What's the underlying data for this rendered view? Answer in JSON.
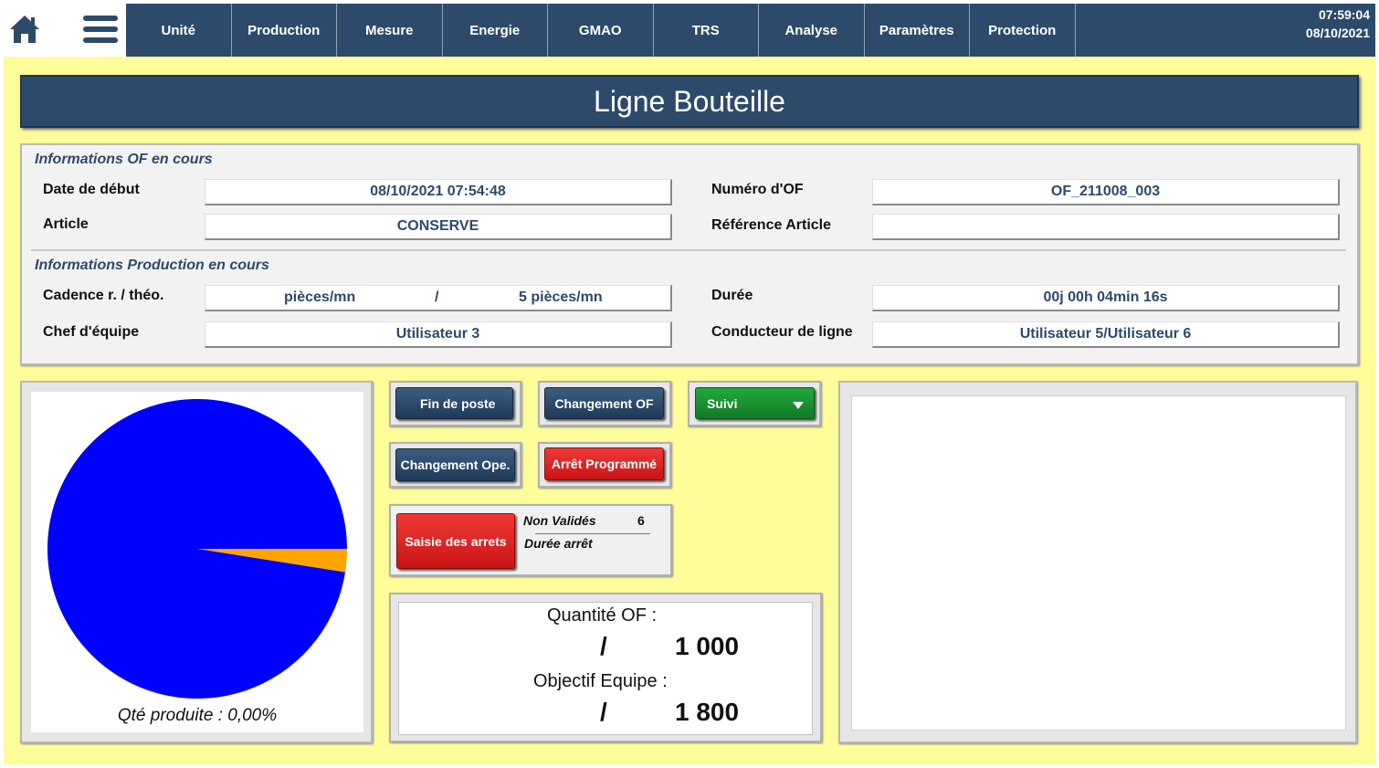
{
  "nav": {
    "items": [
      "Unité",
      "Production",
      "Mesure",
      "Energie",
      "GMAO",
      "TRS",
      "Analyse",
      "Paramètres",
      "Protection"
    ],
    "time": "07:59:04",
    "date": "08/10/2021"
  },
  "page_title": "Ligne Bouteille",
  "of_info": {
    "section_title": "Informations OF en cours",
    "start_date_label": "Date de début",
    "start_date_value": "08/10/2021 07:54:48",
    "of_number_label": "Numéro d'OF",
    "of_number_value": "OF_211008_003",
    "article_label": "Article",
    "article_value": "CONSERVE",
    "article_ref_label": "Référence Article",
    "article_ref_value": ""
  },
  "production_info": {
    "section_title": "Informations Production en cours",
    "cadence_label": "Cadence r. / théo.",
    "cadence_real": "pièces/mn",
    "cadence_sep": "/",
    "cadence_theo": "5 pièces/mn",
    "duration_label": "Durée",
    "duration_value": "00j 00h 04min 16s",
    "team_leader_label": "Chef d'équipe",
    "team_leader_value": "Utilisateur 3",
    "line_driver_label": "Conducteur de ligne",
    "line_driver_value": "Utilisateur 5/Utilisateur 6"
  },
  "buttons": {
    "end_shift": "Fin de poste",
    "change_of": "Changement OF",
    "followup": "Suivi",
    "change_ope": "Changement Ope.",
    "planned_stop": "Arrêt Programmé",
    "enter_stops": "Saisie des arrets"
  },
  "stops": {
    "not_validated_label": "Non Validés",
    "not_validated_value": "6",
    "stop_duration_label": "Durée arrêt"
  },
  "quantity": {
    "of_label": "Quantité OF :",
    "of_sep": "/",
    "of_value": "1 000",
    "team_label": "Objectif Equipe :",
    "team_sep": "/",
    "team_value": "1 800"
  },
  "pie": {
    "caption": "Qté produite : 0,00%",
    "slices": [
      {
        "label": "remaining",
        "fraction": 0.975,
        "color": "#0000ff"
      },
      {
        "label": "other",
        "fraction": 0.025,
        "color": "#ffa500"
      }
    ]
  },
  "colors": {
    "nav_bg": "#2e4a6a",
    "main_bg": "#fffd99",
    "pie_main": "#0000ff",
    "pie_minor": "#ffa500"
  }
}
